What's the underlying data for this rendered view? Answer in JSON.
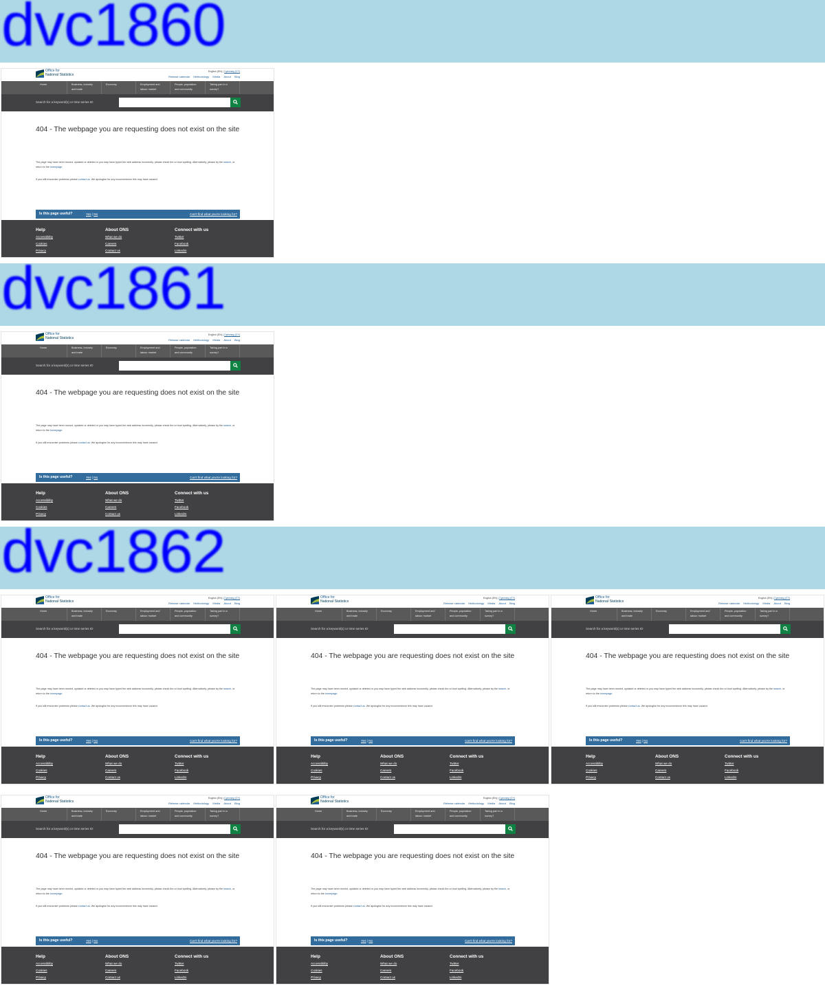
{
  "banners": [
    "dvc1860",
    "dvc1861",
    "dvc1862"
  ],
  "page": {
    "logo": {
      "line1": "Office for",
      "line2": "National Statistics"
    },
    "language": {
      "current": "English (EN)",
      "separator": "|",
      "other": "Cymraeg (CY)"
    },
    "top_links": [
      "Release calendar",
      "Methodology",
      "Media",
      "About",
      "Blog"
    ],
    "nav": [
      {
        "line1": "Home",
        "line2": ""
      },
      {
        "line1": "Business, industry",
        "line2": "and trade"
      },
      {
        "line1": "Economy",
        "line2": ""
      },
      {
        "line1": "Employment and",
        "line2": "labour market"
      },
      {
        "line1": "People, population",
        "line2": "and community"
      },
      {
        "line1": "Taking part in a",
        "line2": "survey?"
      }
    ],
    "search": {
      "label": "Search for a keyword(s) or time series ID",
      "value": ""
    },
    "title": "404 - The webpage you are requesting does not exist on the site",
    "para1": {
      "text_a": "The page may have been moved, updated or deleted or you may have typed the web address incorrectly, please check the url and spelling. Alternatively, please try the ",
      "link_search": "search",
      "text_b": ", or return to the ",
      "link_home": "homepage",
      "text_c": "."
    },
    "para2": {
      "text_a": "If you still encounter problems please ",
      "link_contact": "contact us",
      "text_b": ". We apologise for any inconvenience this may have caused."
    },
    "feedback": {
      "question": "Is this page useful?",
      "yes": "Yes",
      "separator": "|",
      "no": "No",
      "cant_find": "Can't find what you're looking for?"
    },
    "footer": {
      "help": {
        "heading": "Help",
        "links": [
          "Accessibility",
          "Cookies",
          "Privacy"
        ]
      },
      "about": {
        "heading": "About ONS",
        "links": [
          "What we do",
          "Careers",
          "Contact us"
        ]
      },
      "connect": {
        "heading": "Connect with us",
        "links": [
          "Twitter",
          "Facebook",
          "LinkedIn"
        ]
      }
    }
  },
  "colors": {
    "banner_bg": "#add8e6",
    "banner_text": "#0000ff",
    "ons_blue": "#206095",
    "nav_bg": "#595959",
    "search_bg": "#414042",
    "search_button": "#0f8243",
    "footer_bg": "#414042"
  }
}
